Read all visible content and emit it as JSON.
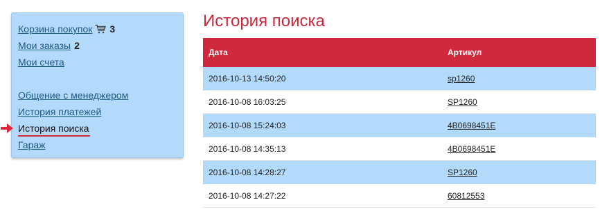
{
  "sidebar": {
    "cart": {
      "label": "Корзина покупок",
      "count": "3",
      "icon": "cart-icon"
    },
    "orders": {
      "label": "Мои заказы",
      "count": "2"
    },
    "invoices": {
      "label": "Мои счета"
    },
    "manager": {
      "label": "Общение с менеджером"
    },
    "payments": {
      "label": "История платежей"
    },
    "search_history": {
      "label": "История поиска",
      "active": true,
      "marker_color": "#d0293d"
    },
    "garage": {
      "label": "Гараж"
    }
  },
  "main": {
    "title": "История поиска",
    "table": {
      "headers": {
        "date": "Дата",
        "article": "Артикул"
      },
      "rows": [
        {
          "date": "2016-10-13 14:50:20",
          "article": "sp1260"
        },
        {
          "date": "2016-10-08 16:03:25",
          "article": "SP1260"
        },
        {
          "date": "2016-10-08 15:24:03",
          "article": "4B0698451E"
        },
        {
          "date": "2016-10-08 14:35:13",
          "article": "4B0698451E"
        },
        {
          "date": "2016-10-08 14:28:27",
          "article": "SP1260"
        },
        {
          "date": "2016-10-08 14:27:22",
          "article": "60812553"
        }
      ]
    }
  },
  "colors": {
    "accent_red": "#d0293d",
    "title_red": "#c8283b",
    "sidebar_bg": "#b3d9fb",
    "link_blue": "#1f5a85"
  }
}
